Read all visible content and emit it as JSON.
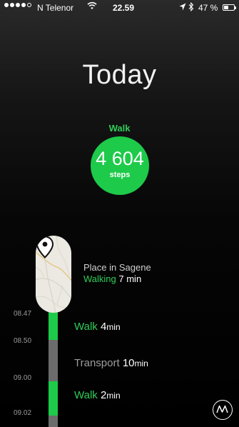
{
  "status_bar": {
    "carrier": "N Telenor",
    "time": "22.59",
    "battery_percent": "47 %",
    "battery_level": 0.47,
    "icons": [
      "signal-dots-icon",
      "wifi-icon",
      "location-arrow-icon",
      "bluetooth-icon",
      "battery-icon"
    ]
  },
  "title": "Today",
  "summary": {
    "activity": "Walk",
    "steps": "4 604",
    "steps_unit": "steps"
  },
  "place": {
    "name": "Place in Sagene",
    "activity": "Walking",
    "duration": "7 min",
    "icons": [
      "map-thumbnail",
      "location-pin-icon"
    ]
  },
  "timeline": {
    "times": [
      "08.47",
      "08.50",
      "09.00",
      "09.02"
    ],
    "segments": [
      {
        "name": "Walk",
        "duration": "4",
        "unit": "min",
        "type": "walk"
      },
      {
        "name": "Transport",
        "duration": "10",
        "unit": "min",
        "type": "transport"
      },
      {
        "name": "Walk",
        "duration": "2",
        "unit": "min",
        "type": "walk"
      }
    ]
  },
  "logo_icon": "moves-logo-icon",
  "colors": {
    "accent_green": "#1dca4a",
    "transport_grey": "#6c6c6c",
    "background": "#000000"
  }
}
